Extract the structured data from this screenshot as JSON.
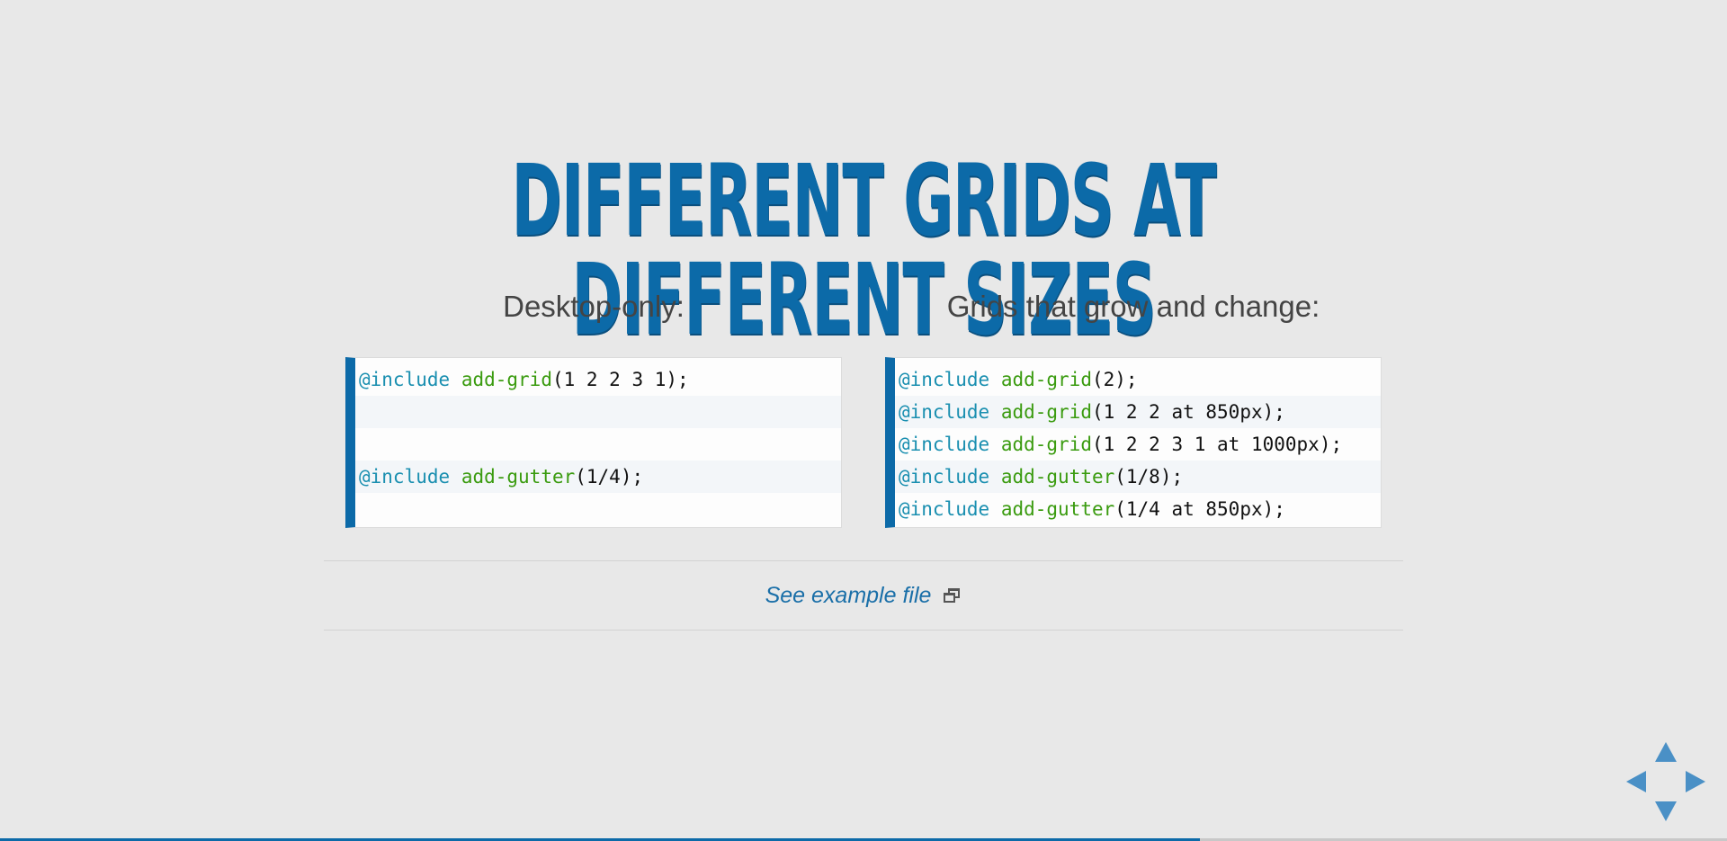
{
  "slide": {
    "title": "Different grids at different sizes",
    "left": {
      "heading": "Desktop-only:",
      "lines": [
        {
          "kw": "@include",
          "fn": "add-grid",
          "args": "(1 2 2 3 1);"
        },
        {
          "kw": "",
          "fn": "",
          "args": ""
        },
        {
          "kw": "",
          "fn": "",
          "args": ""
        },
        {
          "kw": "@include",
          "fn": "add-gutter",
          "args": "(1/4);"
        },
        {
          "kw": "",
          "fn": "",
          "args": ""
        }
      ]
    },
    "right": {
      "heading": "Grids that grow and change:",
      "lines": [
        {
          "kw": "@include",
          "fn": "add-grid",
          "args": "(2);"
        },
        {
          "kw": "@include",
          "fn": "add-grid",
          "args": "(1 2 2 at 850px);"
        },
        {
          "kw": "@include",
          "fn": "add-grid",
          "args": "(1 2 2 3 1 at 1000px);"
        },
        {
          "kw": "@include",
          "fn": "add-gutter",
          "args": "(1/8);"
        },
        {
          "kw": "@include",
          "fn": "add-gutter",
          "args": "(1/4 at 850px);"
        }
      ]
    },
    "example_link": "See example file",
    "external_icon": "external-window-icon"
  },
  "navigation": {
    "up": "arrow-up-icon",
    "down": "arrow-down-icon",
    "left": "arrow-left-icon",
    "right": "arrow-right-icon"
  },
  "progress": {
    "fraction": 0.695
  },
  "colors": {
    "accent": "#0c6aa8",
    "keyword": "#1a8fb0",
    "function": "#3a9b0f",
    "nav_arrow": "#4a90c6",
    "background": "#e8e8e8"
  }
}
